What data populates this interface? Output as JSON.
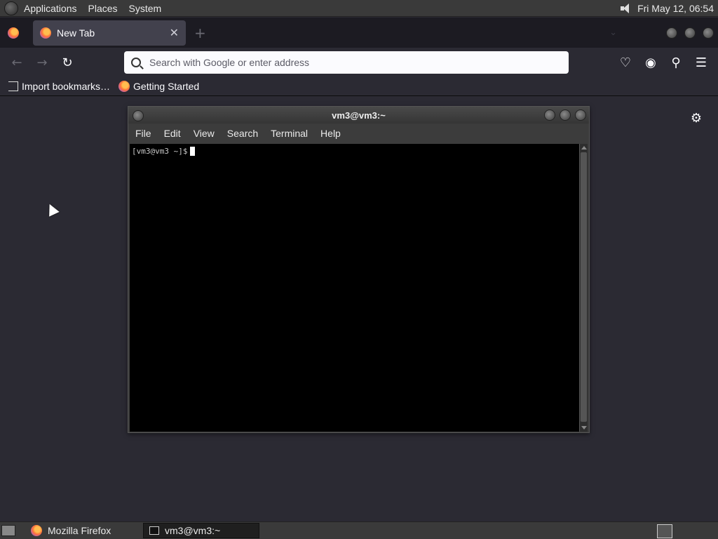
{
  "top_panel": {
    "menus": [
      "Applications",
      "Places",
      "System"
    ],
    "clock": "Fri May 12, 06:54"
  },
  "browser": {
    "tab": {
      "title": "New Tab"
    },
    "urlbar": {
      "placeholder": "Search with Google or enter address",
      "value": ""
    },
    "bookmarks": [
      "Import bookmarks…",
      "Getting Started"
    ]
  },
  "terminal": {
    "title": "vm3@vm3:~",
    "menu": [
      "File",
      "Edit",
      "View",
      "Search",
      "Terminal",
      "Help"
    ],
    "prompt": "[vm3@vm3 ~]$"
  },
  "taskbar": {
    "items": [
      "Mozilla Firefox",
      "vm3@vm3:~"
    ]
  }
}
